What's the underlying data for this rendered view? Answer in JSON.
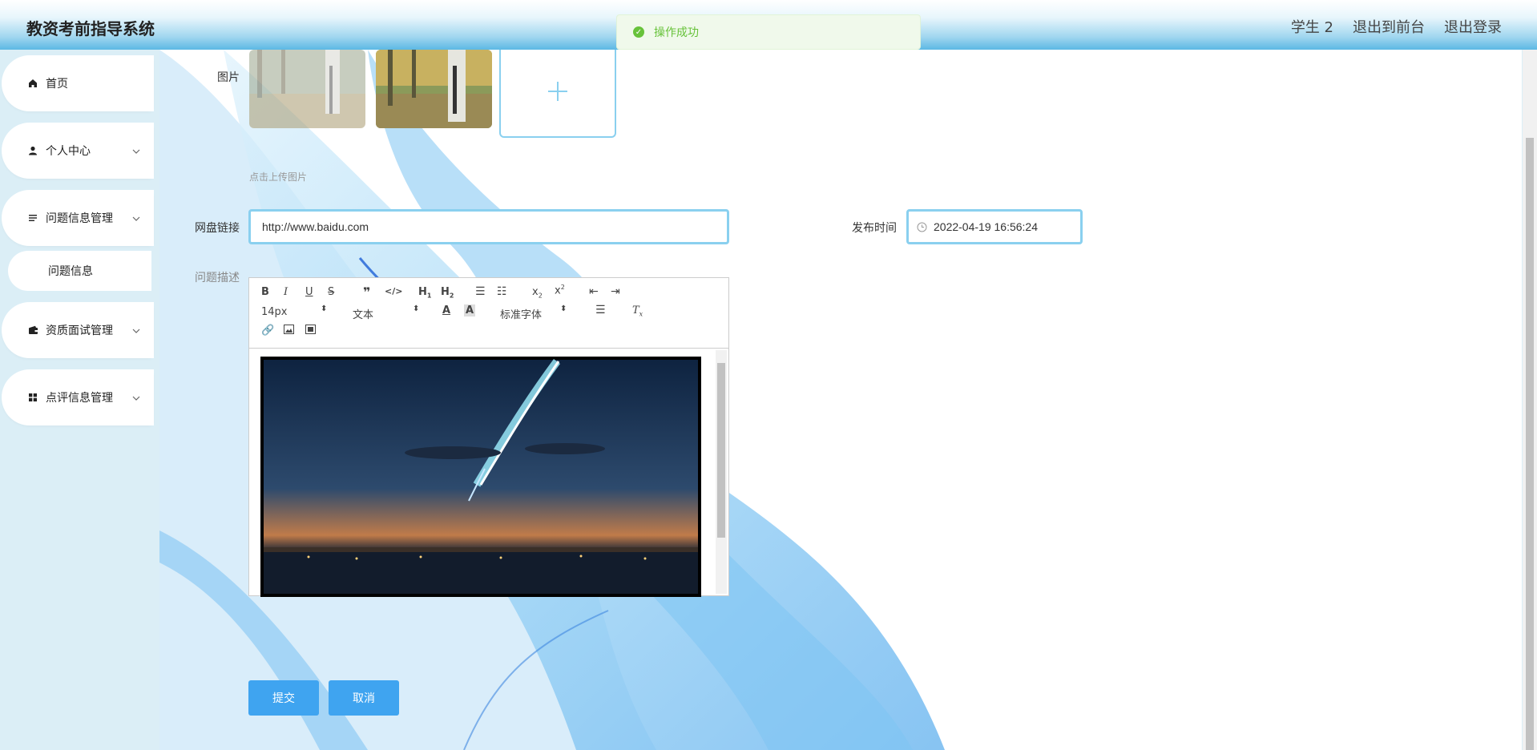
{
  "app": {
    "title": "教资考前指导系统"
  },
  "header": {
    "user": "学生 2",
    "to_front": "退出到前台",
    "logout": "退出登录"
  },
  "toast": {
    "message": "操作成功"
  },
  "sidebar": {
    "items": [
      {
        "label": "首页",
        "icon": "home-icon"
      },
      {
        "label": "个人中心",
        "icon": "user-icon"
      },
      {
        "label": "问题信息管理",
        "icon": "list-icon"
      },
      {
        "label": "资质面试管理",
        "icon": "wallet-icon"
      },
      {
        "label": "点评信息管理",
        "icon": "grid-icon"
      }
    ],
    "subitem": "问题信息"
  },
  "form": {
    "image_label": "图片",
    "upload_hint": "点击上传图片",
    "link_label": "网盘链接",
    "link_value": "http://www.baidu.com",
    "time_label": "发布时间",
    "time_value": "2022-04-19 16:56:24",
    "desc_label": "问题描述"
  },
  "editor": {
    "font_size": "14px",
    "block_type": "文本",
    "font_family": "标准字体",
    "tool_h1": "H",
    "tool_h2": "H"
  },
  "buttons": {
    "submit": "提交",
    "cancel": "取消"
  },
  "colors": {
    "accent": "#3fa4f0",
    "border": "#8ad0ef",
    "success": "#67c23a"
  }
}
